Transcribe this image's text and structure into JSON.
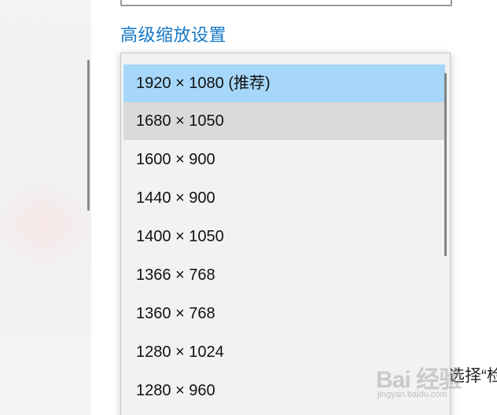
{
  "settings": {
    "advanced_scaling_link": "高级缩放设置",
    "obscured_text": "选择“检"
  },
  "dropdown": {
    "options": [
      {
        "label": "1920 × 1080 (推荐)",
        "state": "selected"
      },
      {
        "label": "1680 × 1050",
        "state": "hover"
      },
      {
        "label": "1600 × 900",
        "state": "normal"
      },
      {
        "label": "1440 × 900",
        "state": "normal"
      },
      {
        "label": "1400 × 1050",
        "state": "normal"
      },
      {
        "label": "1366 × 768",
        "state": "normal"
      },
      {
        "label": "1360 × 768",
        "state": "normal"
      },
      {
        "label": "1280 × 1024",
        "state": "normal"
      },
      {
        "label": "1280 × 960",
        "state": "normal"
      }
    ]
  },
  "watermark": {
    "text": "Bai 经验",
    "sub": "jingyan.baidu.com"
  },
  "colors": {
    "link": "#1478c7",
    "selected_bg": "#a6d7fb",
    "hover_bg": "#dadada",
    "popup_bg": "#f2f2f2"
  }
}
